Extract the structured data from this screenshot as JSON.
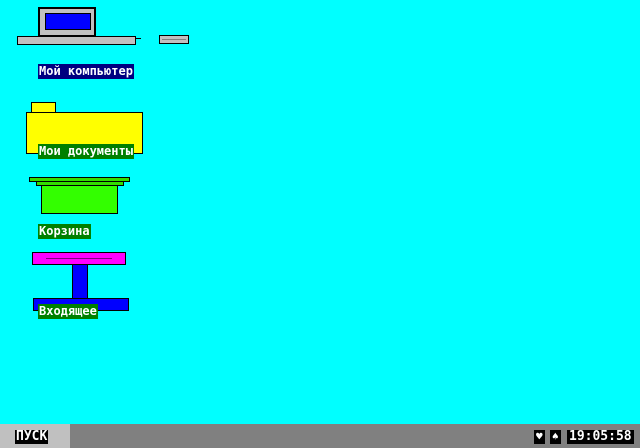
{
  "desktop": {
    "background": "#00ffff",
    "icons": [
      {
        "label": "Мой компьютер",
        "icon": "computer-icon",
        "label_bg": "#000080"
      },
      {
        "label": "Мои документы",
        "icon": "folder-icon",
        "label_bg": "#008000"
      },
      {
        "label": "Корзина",
        "icon": "recycle-bin-icon",
        "label_bg": "#008000"
      },
      {
        "label": "Входящее",
        "icon": "inbox-icon",
        "label_bg": "#008000"
      }
    ]
  },
  "taskbar": {
    "start_label": "ПУСК",
    "tray": {
      "icon1": "♥",
      "icon2": "♠"
    },
    "clock": "19:05:58"
  }
}
